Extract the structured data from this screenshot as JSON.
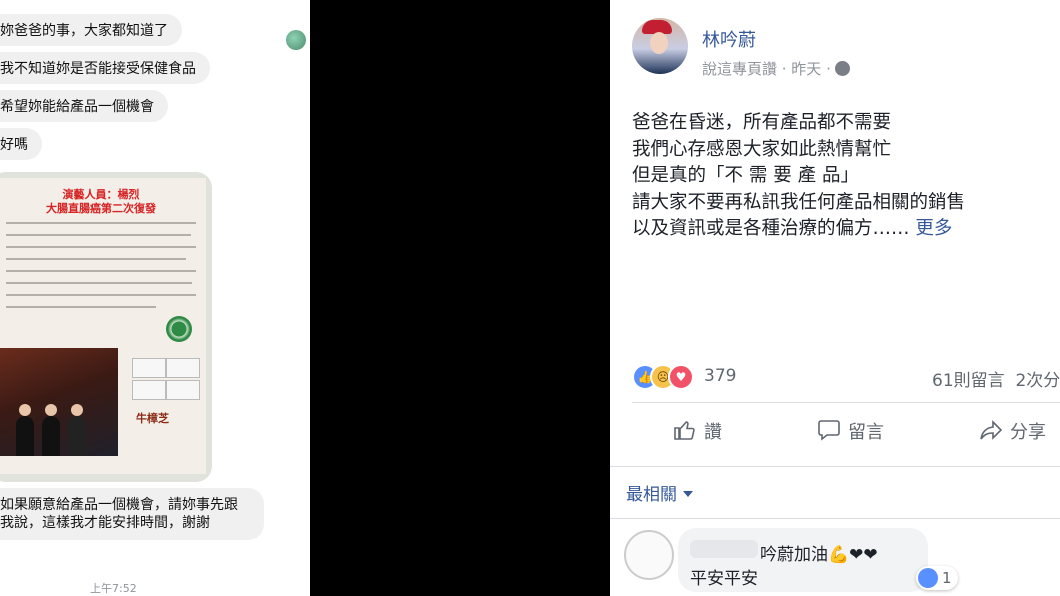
{
  "chat": {
    "messages": [
      "妳爸爸的事，大家都知道了",
      "我不知道妳是否能接受保健食品",
      "希望妳能給產品一個機會",
      "好嗎"
    ],
    "poster": {
      "title_line1": "演藝人員：楊烈",
      "title_line2": "大腸直腸癌第二次復發",
      "brand": "牛樟芝"
    },
    "last_message": "如果願意給產品一個機會，請妳事先跟我說，這樣我才能安排時間，謝謝",
    "timestamp": "上午7:52"
  },
  "post": {
    "author": "林吟蔚",
    "meta_text": "說這專頁讚 · 昨天 ·",
    "body_lines": [
      "爸爸在昏迷，所有產品都不需要",
      "我們心存感恩大家如此熱情幫忙",
      "但是真的「不 需 要 產 品」",
      "請大家不要再私訊我任何產品相關的銷售"
    ],
    "body_last_line": "以及資訊或是各種治療的偏方……",
    "more_label": "更多",
    "reaction_count": "379",
    "comment_count": "61則留言",
    "share_count": "2次分",
    "actions": {
      "like": "讚",
      "comment": "留言",
      "share": "分享"
    },
    "sort_label": "最相關",
    "comment": {
      "line1": "吟蔚加油💪❤❤",
      "line2": "平安平安",
      "likes": "1"
    }
  },
  "colors": {
    "link": "#365899",
    "secondary": "#90949c",
    "like_blue": "#5890ff",
    "love_red": "#f25268"
  }
}
